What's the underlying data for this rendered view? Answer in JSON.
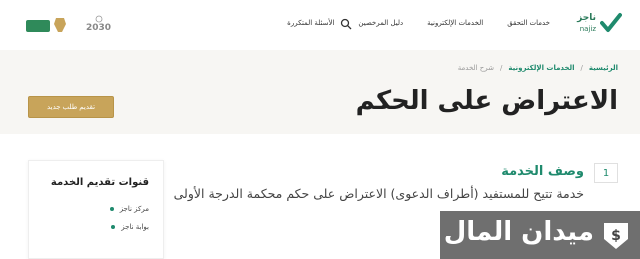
{
  "header": {
    "logo_text": "ناجز",
    "logo_sub": "najiz",
    "nav": [
      "خدمات التحقق",
      "الخدمات الإلكترونية",
      "دليل المرخصين",
      "الأسئلة المتكررة"
    ],
    "vision_label": "2030"
  },
  "breadcrumb": {
    "home": "الرئيسية",
    "sep1": "/",
    "services": "الخدمات الإلكترونية",
    "sep2": "/",
    "current": "شرح الخدمة"
  },
  "page": {
    "title": "الاعتراض على الحكم",
    "new_request_label": "تقديم طلب جديد"
  },
  "section": {
    "number": "1",
    "title": "وصف الخدمة",
    "text": "خدمة تتيح للمستفيد (أطراف الدعوى) الاعتراض على حكم محكمة الدرجة الأولى"
  },
  "side_panel": {
    "title": "قنوات تقديم الخدمة",
    "items": [
      "مركز ناجز",
      "بوابة ناجز"
    ]
  },
  "watermark": {
    "text": "ميدان المال"
  },
  "colors": {
    "brand_green": "#1f8a6d",
    "gold_button": "#c8a45a",
    "hero_bg": "#f7f6f3"
  }
}
